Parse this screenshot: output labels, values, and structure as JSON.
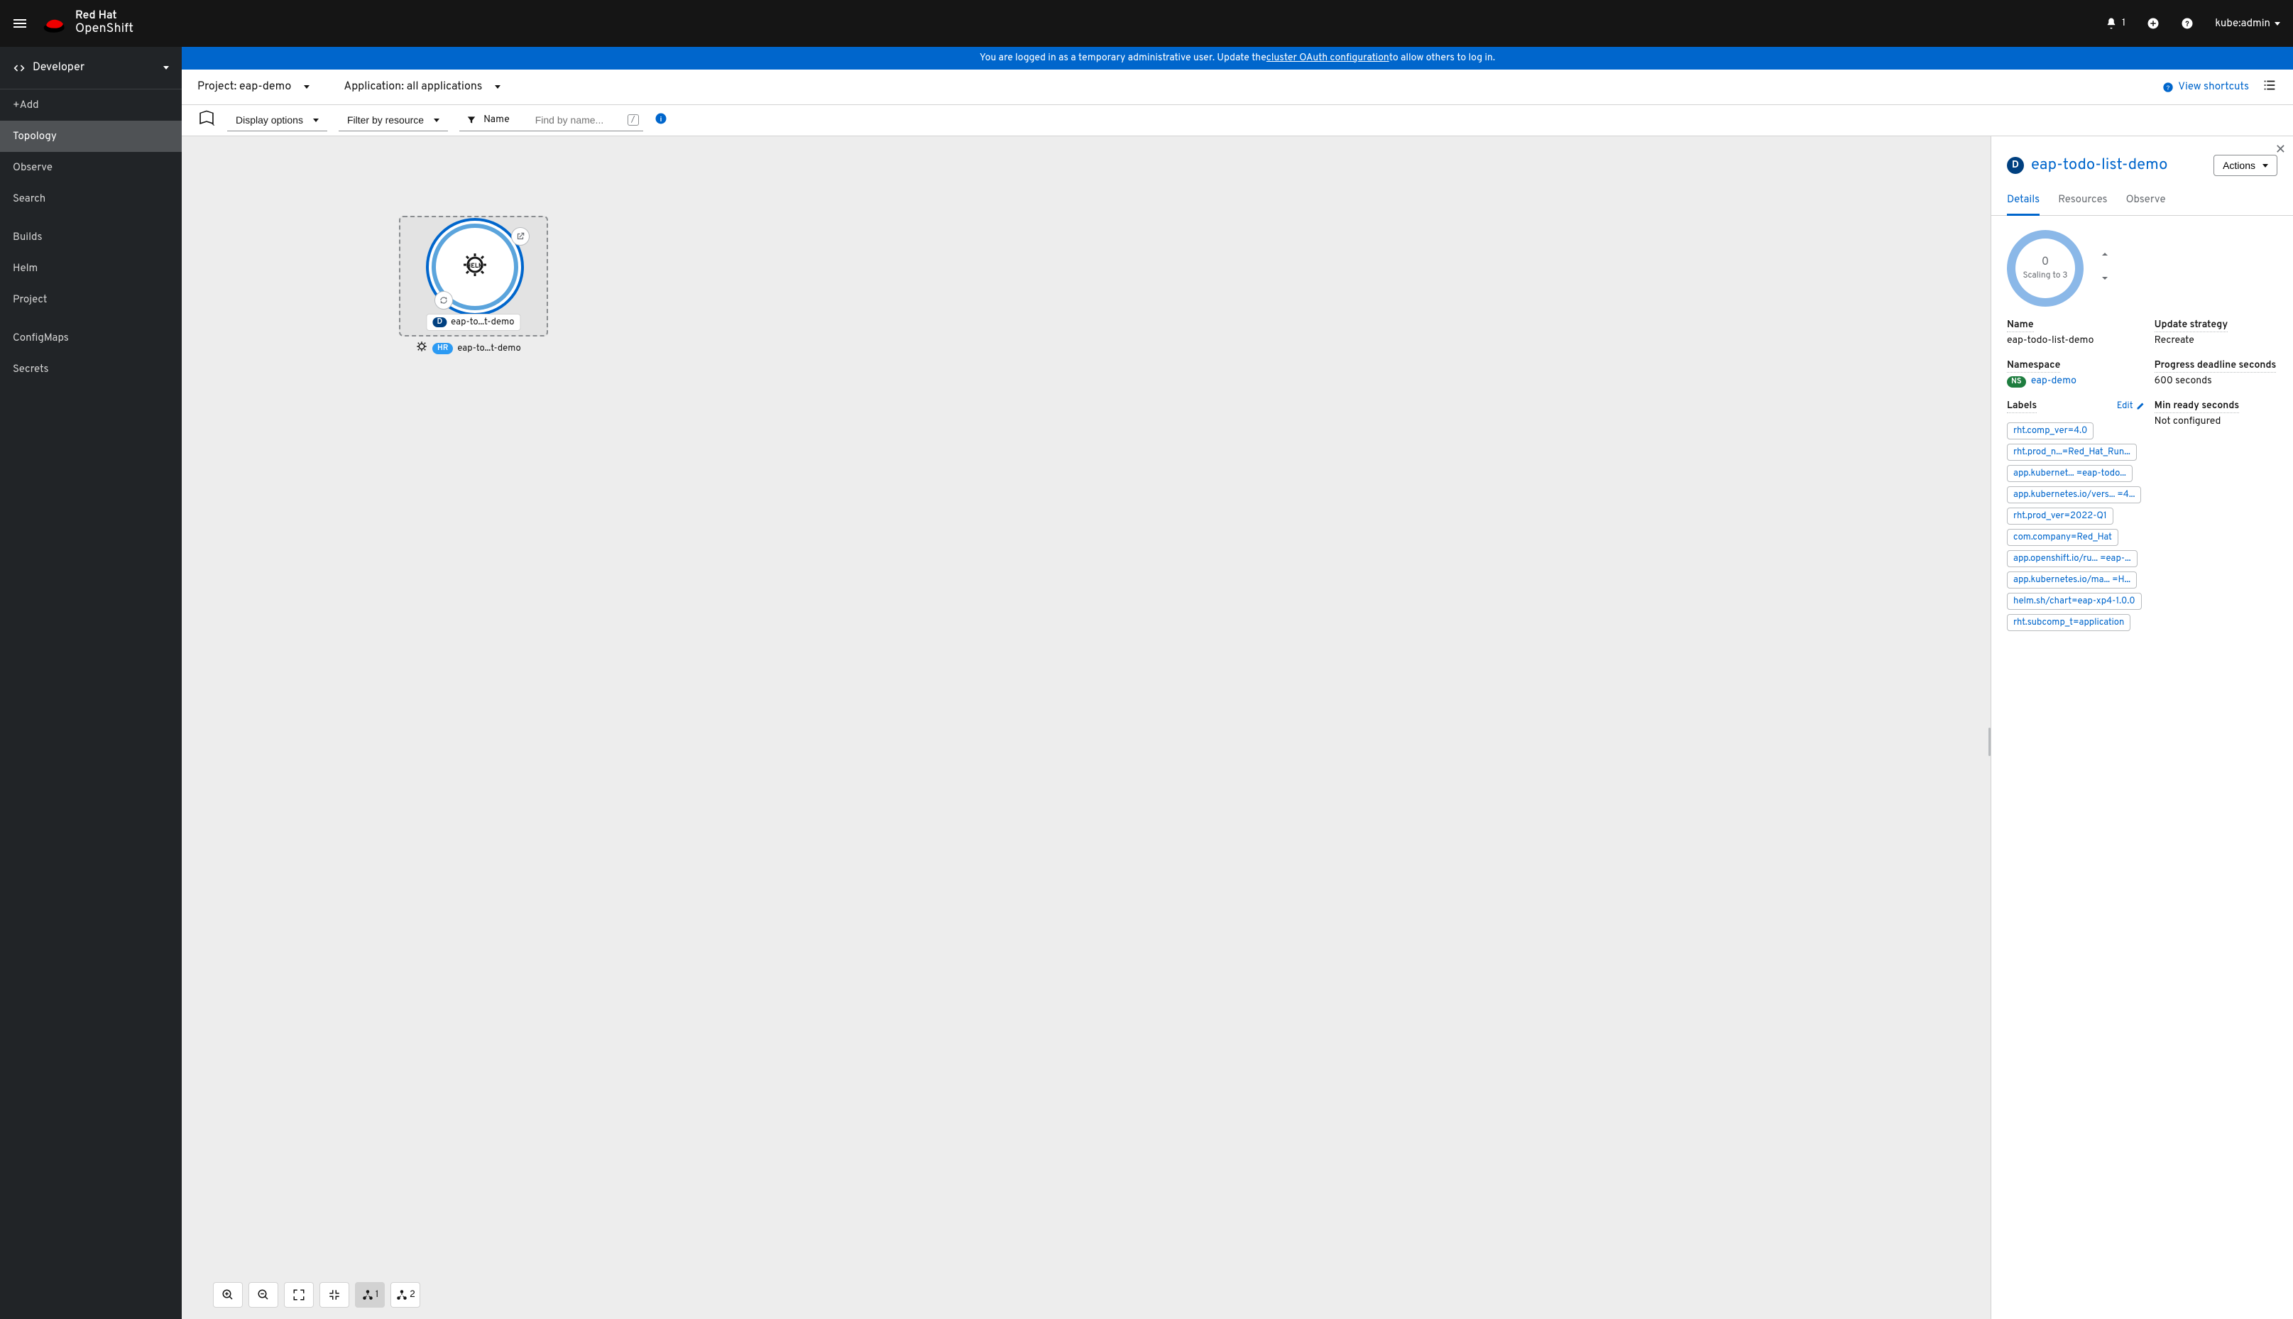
{
  "brand": {
    "line1": "Red Hat",
    "line2": "OpenShift"
  },
  "masthead": {
    "notification_count": "1",
    "username": "kube:admin"
  },
  "perspective": "Developer",
  "nav": {
    "add": "+Add",
    "topology": "Topology",
    "observe": "Observe",
    "search": "Search",
    "builds": "Builds",
    "helm": "Helm",
    "project": "Project",
    "configmaps": "ConfigMaps",
    "secrets": "Secrets"
  },
  "banner": {
    "prefix": "You are logged in as a temporary administrative user. Update the ",
    "link": "cluster OAuth configuration",
    "suffix": " to allow others to log in."
  },
  "context": {
    "project_label": "Project: eap-demo",
    "application_label": "Application: all applications",
    "view_shortcuts": "View shortcuts"
  },
  "toolbar": {
    "display_options": "Display options",
    "filter_resource": "Filter by resource",
    "name_filter": "Name",
    "find_placeholder": "Find by name..."
  },
  "topology": {
    "node_badge": "D",
    "node_label": "eap-to...t-demo",
    "group_badge": "HR",
    "group_label": "eap-to...t-demo"
  },
  "zoom": {
    "layout1_count": "1",
    "layout2_count": "2"
  },
  "panel": {
    "badge": "D",
    "title": "eap-todo-list-demo",
    "actions": "Actions",
    "tabs": {
      "details": "Details",
      "resources": "Resources",
      "observe": "Observe"
    },
    "scale_count": "0",
    "scale_status": "Scaling to 3",
    "details": {
      "name_label": "Name",
      "name_value": "eap-todo-list-demo",
      "update_label": "Update strategy",
      "update_value": "Recreate",
      "namespace_label": "Namespace",
      "namespace_badge": "NS",
      "namespace_value": "eap-demo",
      "progress_label": "Progress deadline seconds",
      "progress_value": "600 seconds",
      "labels_label": "Labels",
      "edit": "Edit",
      "minready_label": "Min ready seconds",
      "minready_value": "Not configured"
    },
    "labels": [
      "rht.comp_ver=4.0",
      "rht.prod_n...=Red_Hat_Run...",
      "app.kubernet... =eap-todo...",
      "app.kubernetes.io/vers... =4...",
      "rht.prod_ver=2022-Q1",
      "com.company=Red_Hat",
      "app.openshift.io/ru... =eap-...",
      "app.kubernetes.io/ma... =H...",
      "helm.sh/chart=eap-xp4-1.0.0",
      "rht.subcomp_t=application"
    ]
  }
}
